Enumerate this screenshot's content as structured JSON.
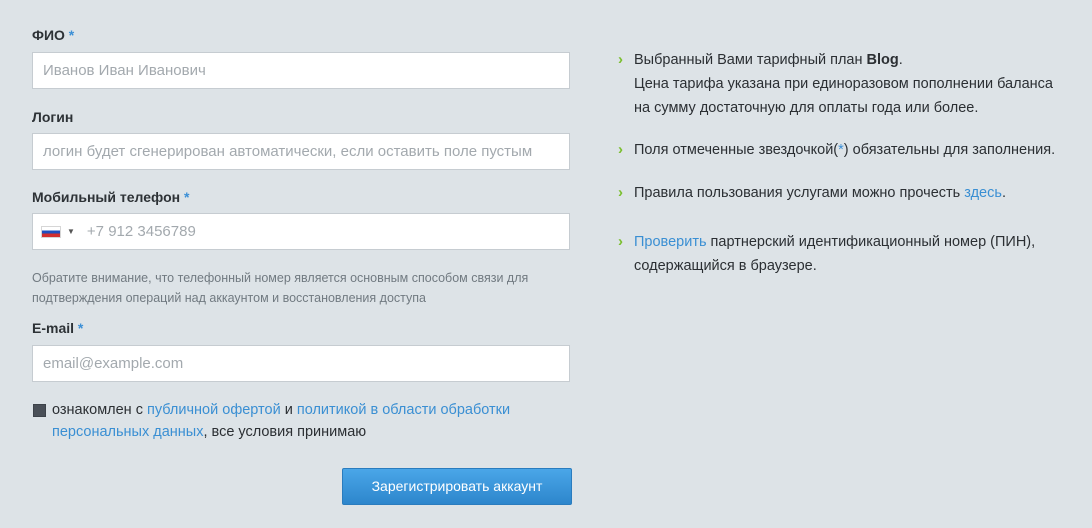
{
  "form": {
    "fio": {
      "label": "ФИО",
      "required_mark": "*",
      "placeholder": "Иванов Иван Иванович"
    },
    "login": {
      "label": "Логин",
      "placeholder": "логин будет сгенерирован автоматически, если оставить поле пустым"
    },
    "phone": {
      "label": "Мобильный телефон",
      "required_mark": "*",
      "country_flag": "russia-flag-icon",
      "caret": "▼",
      "placeholder": "+7 912 3456789"
    },
    "note": "Обратите внимание, что телефонный номер является основным способом связи для подтверждения операций над аккаунтом и восстановления доступа",
    "email": {
      "label": "E-mail",
      "required_mark": "*",
      "placeholder": "email@example.com"
    },
    "consent": {
      "checked": true,
      "prefix": "ознакомлен с ",
      "offer_link": "публичной офертой",
      "and": " и ",
      "policy_link_line1": "политикой в области обработки",
      "policy_link_line2": "персональных данных",
      "suffix": ", все условия принимаю"
    },
    "submit_label": "Зарегистрировать аккаунт"
  },
  "info": {
    "plan": {
      "prefix": "Выбранный Вами тарифный план ",
      "plan_name": "Blog",
      "suffix": ".",
      "line2": "Цена тарифа указана при единоразовом пополнении баланса",
      "line3": "на сумму достаточную для оплаты года или более."
    },
    "required_note": {
      "prefix": "Поля отмеченные звездочкой(",
      "star": "*",
      "suffix": ") обязательны для заполнения."
    },
    "rules": {
      "prefix": "Правила пользования услугами можно прочесть ",
      "link": "здесь",
      "suffix": "."
    },
    "pin": {
      "link": "Проверить",
      "text": " партнерский идентификационный номер (ПИН),",
      "line2": "содержащийся в браузере."
    }
  },
  "colors": {
    "background": "#dde3e7",
    "link": "#3a8fd3",
    "required": "#3b8fd6",
    "bullet": "#7abf2e",
    "button": "#2d86cc"
  }
}
